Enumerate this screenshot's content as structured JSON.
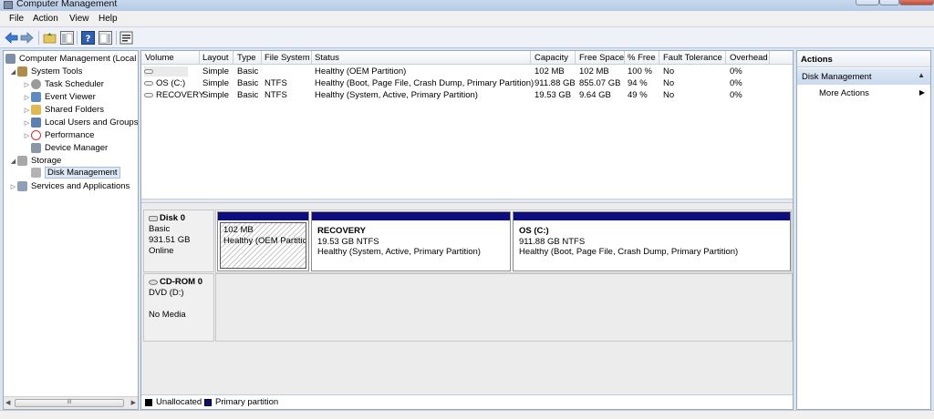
{
  "window": {
    "title": "Computer Management"
  },
  "menu": [
    "File",
    "Action",
    "View",
    "Help"
  ],
  "toolbar": {
    "icons": [
      "back-arrow-icon",
      "forward-arrow-icon",
      "up-folder-icon",
      "show-tree-icon",
      "help-icon",
      "show-pane-icon",
      "properties-icon"
    ]
  },
  "tree": {
    "root": "Computer Management (Local",
    "system_tools": "System Tools",
    "task_scheduler": "Task Scheduler",
    "event_viewer": "Event Viewer",
    "shared_folders": "Shared Folders",
    "local_users": "Local Users and Groups",
    "performance": "Performance",
    "device_manager": "Device Manager",
    "storage": "Storage",
    "disk_management": "Disk Management",
    "services": "Services and Applications",
    "scroll_thumb": "III"
  },
  "volumes": {
    "headers": [
      "Volume",
      "Layout",
      "Type",
      "File System",
      "Status",
      "Capacity",
      "Free Space",
      "% Free",
      "Fault Tolerance",
      "Overhead"
    ],
    "rows": [
      [
        "",
        "Simple",
        "Basic",
        "",
        "Healthy (OEM Partition)",
        "102 MB",
        "102 MB",
        "100 %",
        "No",
        "0%"
      ],
      [
        "OS (C:)",
        "Simple",
        "Basic",
        "NTFS",
        "Healthy (Boot, Page File, Crash Dump, Primary Partition)",
        "911.88 GB",
        "855.07 GB",
        "94 %",
        "No",
        "0%"
      ],
      [
        "RECOVERY",
        "Simple",
        "Basic",
        "NTFS",
        "Healthy (System, Active, Primary Partition)",
        "19.53 GB",
        "9.64 GB",
        "49 %",
        "No",
        "0%"
      ]
    ]
  },
  "disks": {
    "disk0": {
      "name": "Disk 0",
      "type": "Basic",
      "size": "931.51 GB",
      "status": "Online"
    },
    "partitions": {
      "oem": {
        "size": "102 MB",
        "status": "Healthy (OEM Partitio"
      },
      "recovery": {
        "name": "RECOVERY",
        "size": "19.53 GB NTFS",
        "status": "Healthy (System, Active, Primary Partition)"
      },
      "os": {
        "name": "OS  (C:)",
        "size": "911.88 GB NTFS",
        "status": "Healthy (Boot, Page File, Crash Dump, Primary Partition)"
      }
    },
    "cdrom": {
      "name": "CD-ROM 0",
      "type": "DVD (D:)",
      "status": "No Media"
    }
  },
  "legend": {
    "unallocated": "Unallocated",
    "primary": "Primary partition",
    "unallocated_color": "#000000",
    "primary_color": "#0d0d7e"
  },
  "actions": {
    "title": "Actions",
    "section": "Disk Management",
    "more": "More Actions"
  }
}
